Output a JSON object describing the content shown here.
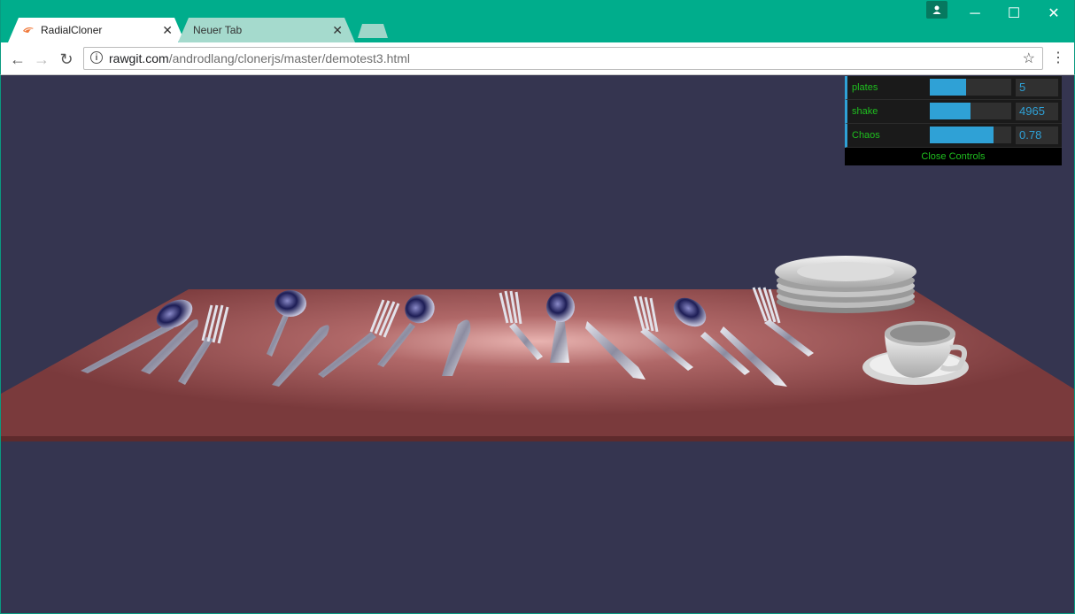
{
  "browser": {
    "tabs": [
      {
        "label": "RadialCloner",
        "active": true
      },
      {
        "label": "Neuer Tab",
        "active": false
      }
    ],
    "url_host": "rawgit.com",
    "url_path": "/androdlang/clonerjs/master/demotest3.html",
    "accent_color": "#00ad8c"
  },
  "gui": {
    "controls": [
      {
        "label": "plates",
        "value": "5",
        "fill_fraction": 0.45
      },
      {
        "label": "shake",
        "value": "4965",
        "fill_fraction": 0.5
      },
      {
        "label": "Chaos",
        "value": "0.78",
        "fill_fraction": 0.78
      }
    ],
    "close_label": "Close Controls"
  },
  "scene": {
    "background_color": "#353550",
    "table_color": "#7a3a3c"
  }
}
